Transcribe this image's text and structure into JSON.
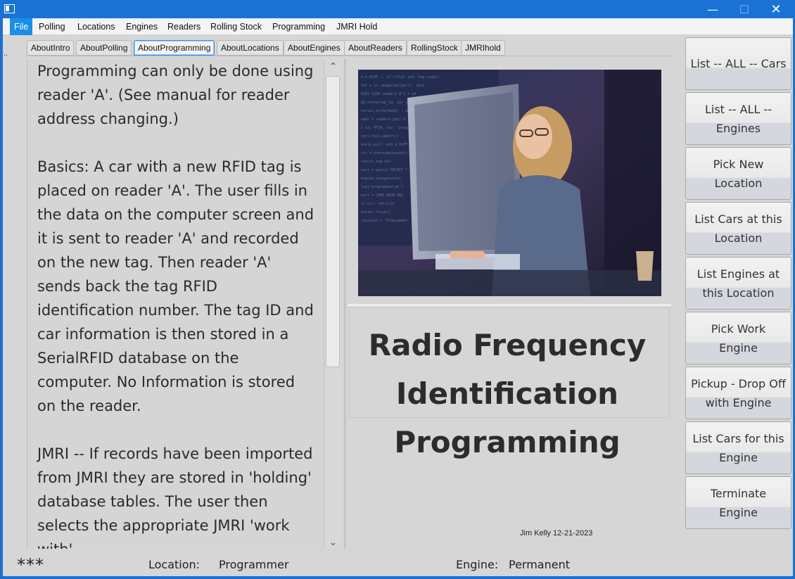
{
  "window": {
    "minimize": "—",
    "maximize": "☐",
    "close": "✕"
  },
  "menu": [
    "File",
    "Polling",
    "Locations",
    "Engines",
    "Readers",
    "Rolling Stock",
    "Programming",
    "JMRI Hold"
  ],
  "tabs": [
    "AboutIntro",
    "AboutPolling",
    "AboutProgramming",
    "AboutLocations",
    "AboutEngines",
    "AboutReaders",
    "RollingStock",
    "JMRIhold"
  ],
  "active_tab": "AboutProgramming",
  "dots": "..",
  "content": {
    "paragraphs": [
      "Programming can only be done using reader 'A'. (See manual for reader address changing.)",
      "Basics: A car with a new RFID tag is placed on reader 'A'. The user fills in the data on the computer screen and it is sent to reader 'A' and recorded on the new tag. Then reader 'A' sends back the tag RFID identification number. The tag ID and car information is then stored in a SerialRFID database on the computer. No Information is stored on the reader.",
      "JMRI -- If records have been imported from JMRI they are stored in 'holding' database tables. The user then selects the appropriate JMRI 'work with'"
    ]
  },
  "scroll": {
    "up": "⌃",
    "down": "⌄"
  },
  "banner": {
    "line1": "Radio Frequency",
    "line2": "Identification",
    "line3": "Programming",
    "credit": "Jim Kelly 12-21-2023"
  },
  "buttons": [
    "List -- ALL -- Cars",
    "List -- ALL -- Engines",
    "Pick New Location",
    "List Cars at this Location",
    "List Engines at this Location",
    "Pick Work Engine",
    "Pickup - Drop Off with Engine",
    "List Cars for this Engine",
    "Terminate Engine"
  ],
  "status": {
    "stars": "***",
    "location_label": "Location:",
    "location_value": "Programmer",
    "engine_label": "Engine:",
    "engine_value": "Permanent"
  }
}
